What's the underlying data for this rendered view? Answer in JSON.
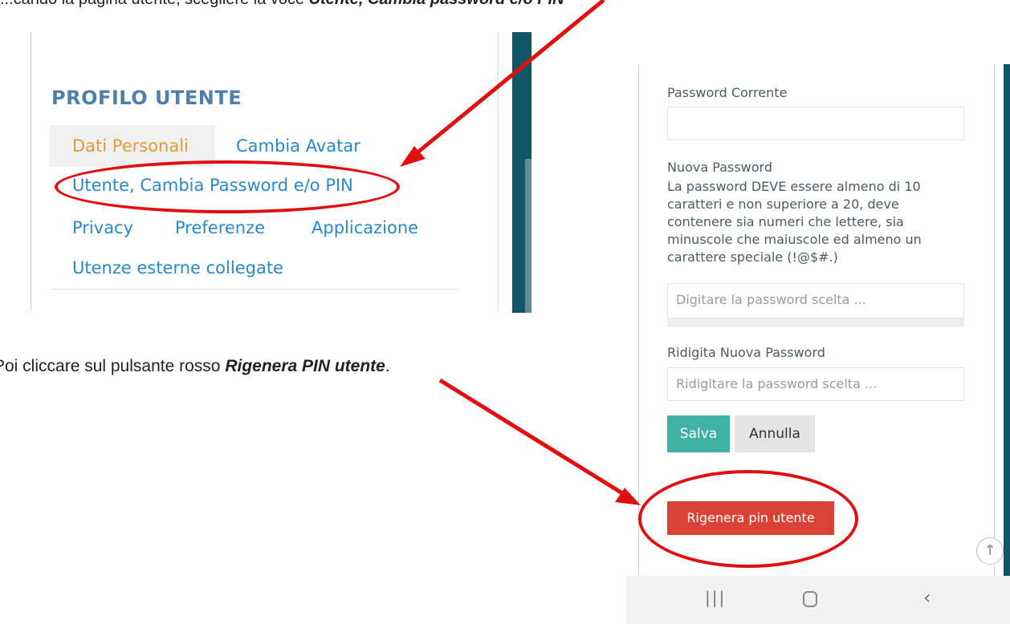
{
  "instructions": {
    "top_prefix": "...cando la pagina utente, scegliere la voce ",
    "top_bold": "Utente, Cambia password e/o PIN",
    "mid_prefix": "Poi cliccare sul pulsante rosso ",
    "mid_bold": "Rigenera PIN utente",
    "mid_suffix": "."
  },
  "profile": {
    "title": "PROFILO UTENTE",
    "menu": {
      "dati": "Dati Personali",
      "avatar": "Cambia Avatar",
      "utente": "Utente, Cambia Password e/o PIN",
      "privacy": "Privacy",
      "preferenze": "Preferenze",
      "applicazione": "Applicazione",
      "utenze": "Utenze esterne collegate"
    }
  },
  "password_form": {
    "current_label": "Password Corrente",
    "current_value": "",
    "new_label": "Nuova Password",
    "new_note": "La password DEVE essere almeno di 10 caratteri e non superiore a 20, deve contenere sia numeri che lettere, sia minuscole che maiuscole ed almeno un carattere speciale (!@$#.)",
    "new_placeholder": "Digitare la password scelta ...",
    "retype_label": "Ridigita Nuova Password",
    "retype_placeholder": "Ridigitare la password scelta ...",
    "save_label": "Salva",
    "cancel_label": "Annulla",
    "regen_label": "Rigenera pin utente"
  },
  "colors": {
    "accent_red": "#e01010",
    "teal": "#0f5766",
    "link_blue": "#2b87c5",
    "active_orange": "#e79a36"
  },
  "icons": {
    "scroll_top": "arrow-up-icon",
    "nav_recents": "recents-icon",
    "nav_home": "home-icon",
    "nav_back": "back-icon"
  }
}
